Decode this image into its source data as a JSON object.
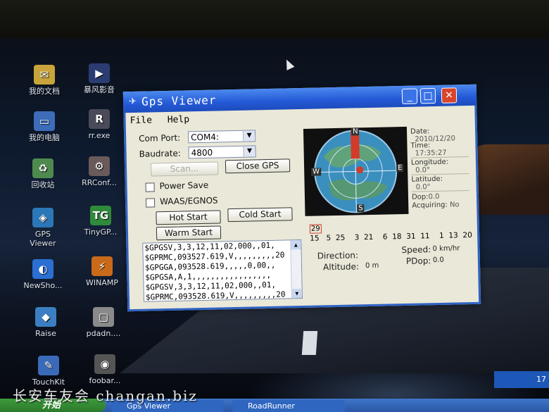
{
  "desktop": {
    "icons": [
      {
        "label": "我的文档",
        "glyph": "✉",
        "color": "#c9a43a"
      },
      {
        "label": "暴风影音",
        "glyph": "▶",
        "color": "#2b3c73"
      },
      {
        "label": "我的电脑",
        "glyph": "▭",
        "color": "#3d6cb8"
      },
      {
        "label": "rr.exe",
        "glyph": "R",
        "color": "#4a4a58"
      },
      {
        "label": "回收站",
        "glyph": "♻",
        "color": "#4e8a4e"
      },
      {
        "label": "RRConf...",
        "glyph": "⚙",
        "color": "#6a5a5a"
      },
      {
        "label": "GPS Viewer",
        "glyph": "◈",
        "color": "#2c77b8"
      },
      {
        "label": "TinyGP...",
        "glyph": "TG",
        "color": "#2f8a3a"
      },
      {
        "label": "NewSho...",
        "glyph": "◐",
        "color": "#2a6fd1"
      },
      {
        "label": "WINAMP",
        "glyph": "⚡",
        "color": "#c86a1a"
      },
      {
        "label": "Raise",
        "glyph": "◆",
        "color": "#3b7fc2"
      },
      {
        "label": "pdadn....",
        "glyph": "▢",
        "color": "#8a8a8a"
      },
      {
        "label": "TouchKit",
        "glyph": "✎",
        "color": "#3a6ab8"
      },
      {
        "label": "foobar...",
        "glyph": "◉",
        "color": "#555555"
      }
    ]
  },
  "watermark": "长安车友会 changan.biz",
  "taskbar": {
    "start_label": "开始",
    "buttons": [
      "Gps Viewer",
      "RoadRunner"
    ],
    "tray_time": "17"
  },
  "window": {
    "title": "Gps Viewer",
    "menu": [
      "File",
      "Help"
    ],
    "com_port_label": "Com Port:",
    "com_port_value": "COM4:",
    "baudrate_label": "Baudrate:",
    "baudrate_value": "4800",
    "scan_label": "Scan...",
    "close_gps_label": "Close GPS",
    "power_save_label": "Power Save",
    "waas_label": "WAAS/EGNOS",
    "hot_start_label": "Hot Start",
    "cold_start_label": "Cold Start",
    "warm_start_label": "Warm Start",
    "nmea_lines": [
      "$GPGSV,3,3,12,11,02,000,,01,",
      "$GPRMC,093527.619,V,,,,,,,,,20",
      "$GPGGA,093528.619,,,,,0,00,,",
      "$GPGSA,A,1,,,,,,,,,,,,,,,,,",
      "$GPGSV,3,3,12,11,02,000,,01,",
      "$GPRMC,093528.619,V,,,,,,,,,20"
    ],
    "sky": {
      "north": "N",
      "south": "S",
      "west": "W",
      "east": "E"
    },
    "info": {
      "date_label": "Date:",
      "date_value": "2010/12/20",
      "time_label": "Time:",
      "time_value": "17:35:27",
      "longitude_label": "Longitude:",
      "longitude_value": "0.0°",
      "latitude_label": "Latitude:",
      "latitude_value": "0.0°",
      "dop_label": "Dop:",
      "dop_value": "0.0",
      "acquiring_label": "Acquiring:",
      "acquiring_value": "No"
    },
    "satellites": {
      "highlighted": "29",
      "ids": [
        "15",
        "5",
        "25",
        "3",
        "21",
        "6",
        "18",
        "31",
        "11",
        "1",
        "13",
        "20"
      ]
    },
    "direction_label": "Direction:",
    "altitude_label": "Altitude:",
    "altitude_value": "0 m",
    "speed_label": "Speed:",
    "speed_value": "0 km/hr",
    "pdop_label": "PDop:",
    "pdop_value": "0.0"
  },
  "colors": {
    "title_blue": "#2459d6",
    "window_bg": "#eae8d8",
    "close_red": "#d8452c",
    "sky_ocean": "#3b8fbf",
    "sat_red": "#d23a2a"
  }
}
